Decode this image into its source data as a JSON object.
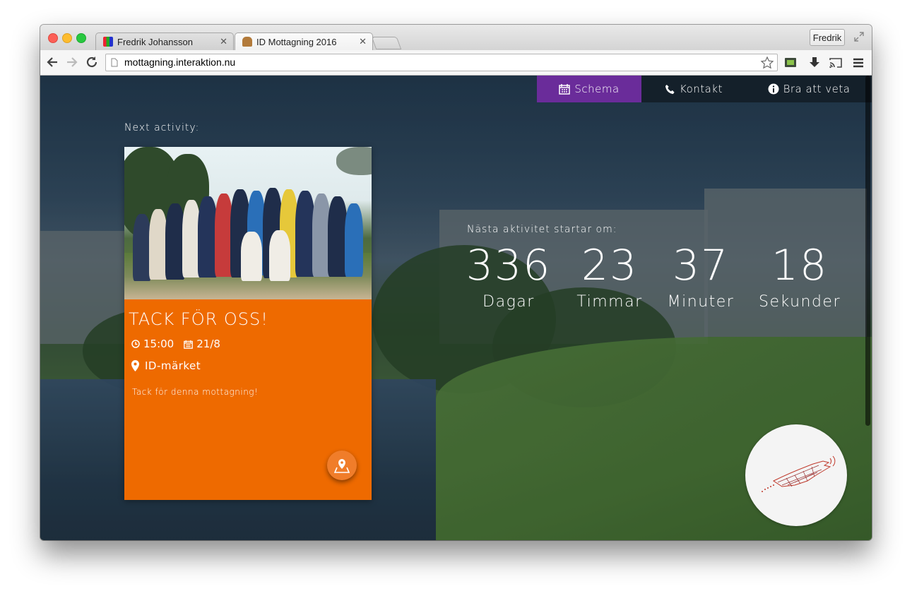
{
  "browser": {
    "tabs": [
      {
        "title": "Fredrik Johansson",
        "active": false
      },
      {
        "title": "ID Mottagning 2016",
        "active": true
      }
    ],
    "profile_label": "Fredrik",
    "url": "mottagning.interaktion.nu"
  },
  "nav": {
    "items": [
      {
        "label": "Schema",
        "icon": "calendar-icon",
        "active": true
      },
      {
        "label": "Kontakt",
        "icon": "phone-icon",
        "active": false
      },
      {
        "label": "Bra att veta",
        "icon": "info-icon",
        "active": false
      }
    ]
  },
  "next_activity": {
    "heading": "Next activity:",
    "title": "TACK FÖR OSS!",
    "time": "15:00",
    "date": "21/8",
    "location": "ID-märket",
    "description": "Tack för denna mottagning!"
  },
  "countdown": {
    "heading": "Nästa aktivitet startar om:",
    "units": [
      {
        "value": "336",
        "label": "Dagar"
      },
      {
        "value": "23",
        "label": "Timmar"
      },
      {
        "value": "37",
        "label": "Minuter"
      },
      {
        "value": "18",
        "label": "Sekunder"
      }
    ]
  },
  "colors": {
    "accent_purple": "#6a2c9a",
    "card_orange": "#ee6a00",
    "nav_dark": "#141e28"
  }
}
